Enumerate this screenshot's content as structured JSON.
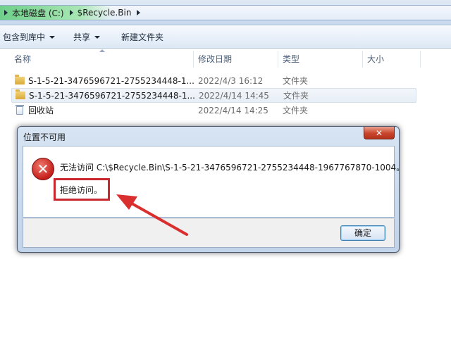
{
  "address": {
    "crumbs": [
      "本地磁盘 (C:)",
      "$Recycle.Bin"
    ]
  },
  "toolbar": {
    "include_library": "包含到库中",
    "share": "共享",
    "new_folder": "新建文件夹"
  },
  "columns": {
    "name": "名称",
    "date": "修改日期",
    "type": "类型",
    "size": "大小"
  },
  "files": [
    {
      "name": "S-1-5-21-3476596721-2755234448-1...",
      "date": "2022/4/3 16:12",
      "type": "文件夹",
      "icon": "folder-icon"
    },
    {
      "name": "S-1-5-21-3476596721-2755234448-1...",
      "date": "2022/4/14 14:45",
      "type": "文件夹",
      "icon": "folder-icon"
    },
    {
      "name": "回收站",
      "date": "2022/4/14 14:25",
      "type": "文件夹",
      "icon": "recycle-bin-icon"
    }
  ],
  "dialog": {
    "title": "位置不可用",
    "message": "无法访问 C:\\$Recycle.Bin\\S-1-5-21-3476596721-2755234448-1967767870-1004。",
    "detail": "拒绝访问。",
    "ok_label": "确定",
    "close_symbol": "✕"
  },
  "colors": {
    "highlight_box": "#c8282d",
    "arrow": "#d9302f",
    "close_button": "#c9452b"
  }
}
